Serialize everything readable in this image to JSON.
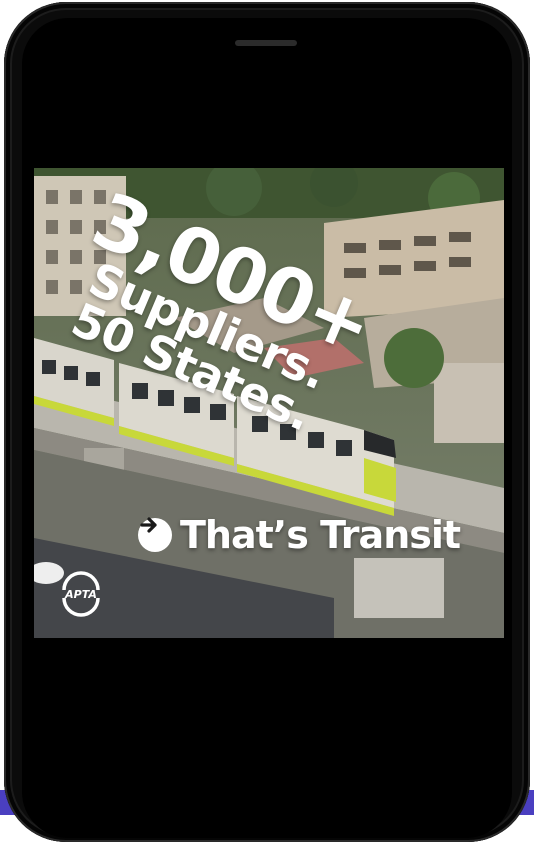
{
  "video": {
    "headline_line1": "3,000+",
    "headline_line2": "Suppliers.",
    "headline_line3": "50 States.",
    "tagline": "That’s Transit",
    "tagline_icon": "arrow-right-circle-icon",
    "logo_text": "APTA"
  },
  "colors": {
    "phone_body": "#0b0b0b",
    "screen": "#000000",
    "train_accent": "#c8d83a",
    "text": "#ffffff",
    "bottom_strip": "#4a3fc0"
  }
}
